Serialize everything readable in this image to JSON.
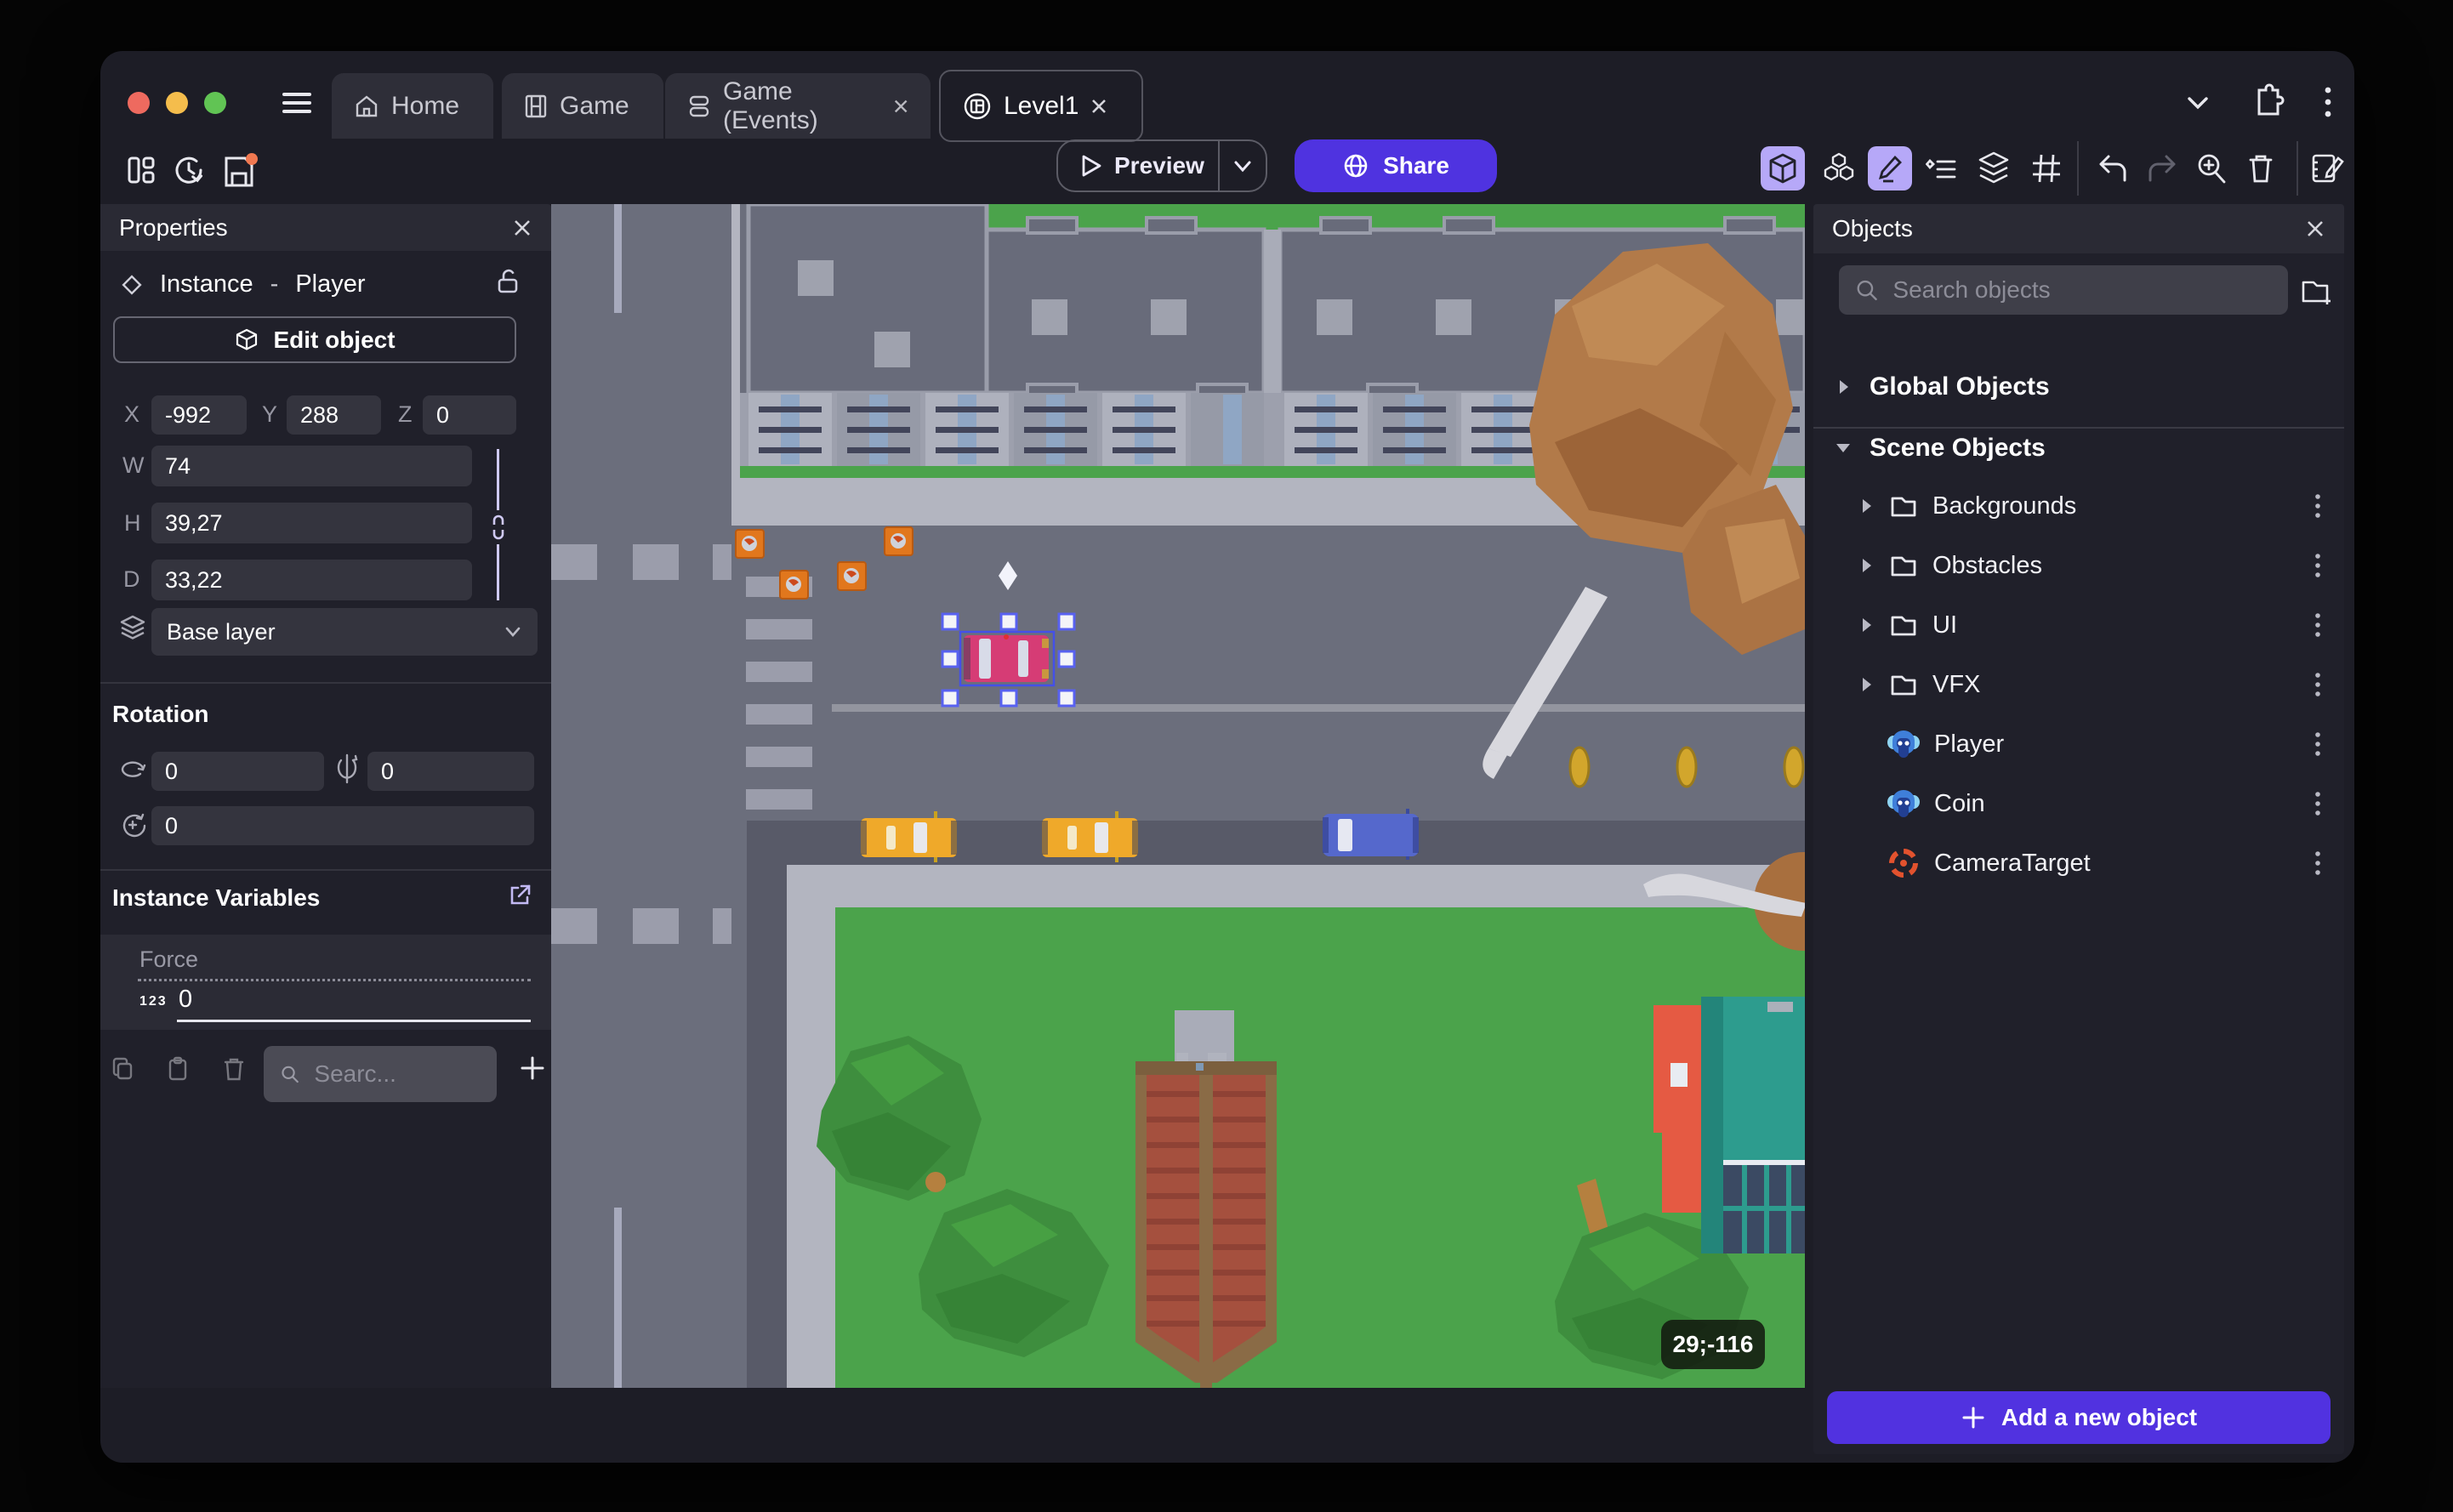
{
  "tabs": {
    "home": "Home",
    "game": "Game",
    "events": "Game (Events)",
    "level": "Level1"
  },
  "toolbar": {
    "preview": "Preview",
    "share": "Share"
  },
  "properties": {
    "title": "Properties",
    "instance_type": "Instance",
    "dash": "-",
    "instance_name": "Player",
    "edit_object": "Edit object",
    "x_label": "X",
    "x": "-992",
    "y_label": "Y",
    "y": "288",
    "z_label": "Z",
    "z": "0",
    "w_label": "W",
    "w": "74",
    "h_label": "H",
    "h": "39,27",
    "d_label": "D",
    "d": "33,22",
    "layer": "Base layer",
    "rotation_title": "Rotation",
    "rot_x": "0",
    "rot_y": "0",
    "rot_z": "0",
    "variables_title": "Instance Variables",
    "var_name": "Force",
    "var_type": "123",
    "var_value": "0",
    "var_search_placeholder": "Searc..."
  },
  "objects": {
    "title": "Objects",
    "search_placeholder": "Search objects",
    "global_group": "Global Objects",
    "scene_group": "Scene Objects",
    "rows": [
      {
        "label": "Backgrounds",
        "type": "folder"
      },
      {
        "label": "Obstacles",
        "type": "folder"
      },
      {
        "label": "UI",
        "type": "folder"
      },
      {
        "label": "VFX",
        "type": "folder"
      },
      {
        "label": "Player",
        "type": "sprite"
      },
      {
        "label": "Coin",
        "type": "sprite"
      },
      {
        "label": "CameraTarget",
        "type": "camera-target"
      }
    ],
    "add_button": "Add a new object"
  },
  "canvas": {
    "cursor_coordinates": "29;-116"
  },
  "colors": {
    "accent_purple": "#5132e0",
    "toolbar_active_bg": "#b6a8f8",
    "grass": "#4ba34b",
    "road": "#6b6e7c",
    "sidewalk": "#b3b5c0",
    "selection": "#5861f0",
    "player_car": "#d63c75",
    "taxi": "#efa92a",
    "blue_car": "#5568cc",
    "coin": "#d2a62c",
    "camera_target": "#e2522e"
  }
}
